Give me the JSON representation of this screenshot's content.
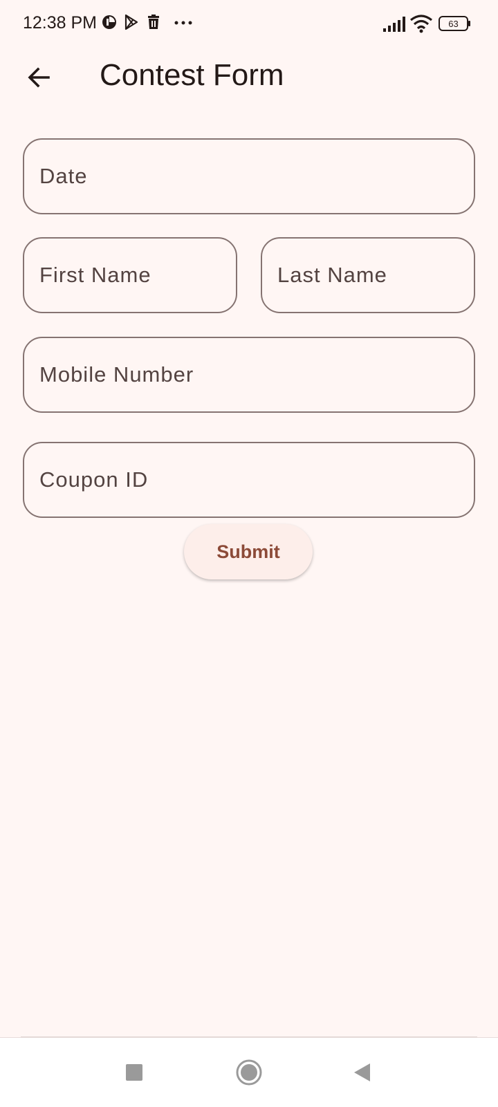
{
  "status_bar": {
    "time": "12:38 PM",
    "left_icons": [
      "data-saver-icon",
      "play-store-icon",
      "trash-icon",
      "more-dots-icon"
    ],
    "battery": "63"
  },
  "app_bar": {
    "title": "Contest Form"
  },
  "form": {
    "date": {
      "placeholder": "Date",
      "value": ""
    },
    "first_name": {
      "placeholder": "First Name",
      "value": ""
    },
    "last_name": {
      "placeholder": "Last Name",
      "value": ""
    },
    "mobile": {
      "placeholder": "Mobile Number",
      "value": ""
    },
    "coupon": {
      "placeholder": "Coupon ID",
      "value": ""
    },
    "submit_label": "Submit"
  },
  "nav_bar": {
    "buttons": [
      "recents-square-icon",
      "home-circle-icon",
      "back-triangle-icon"
    ]
  },
  "colors": {
    "background": "#fff6f4",
    "outline": "#857371",
    "button_bg": "#fdeeea",
    "button_text": "#8c4a38"
  }
}
